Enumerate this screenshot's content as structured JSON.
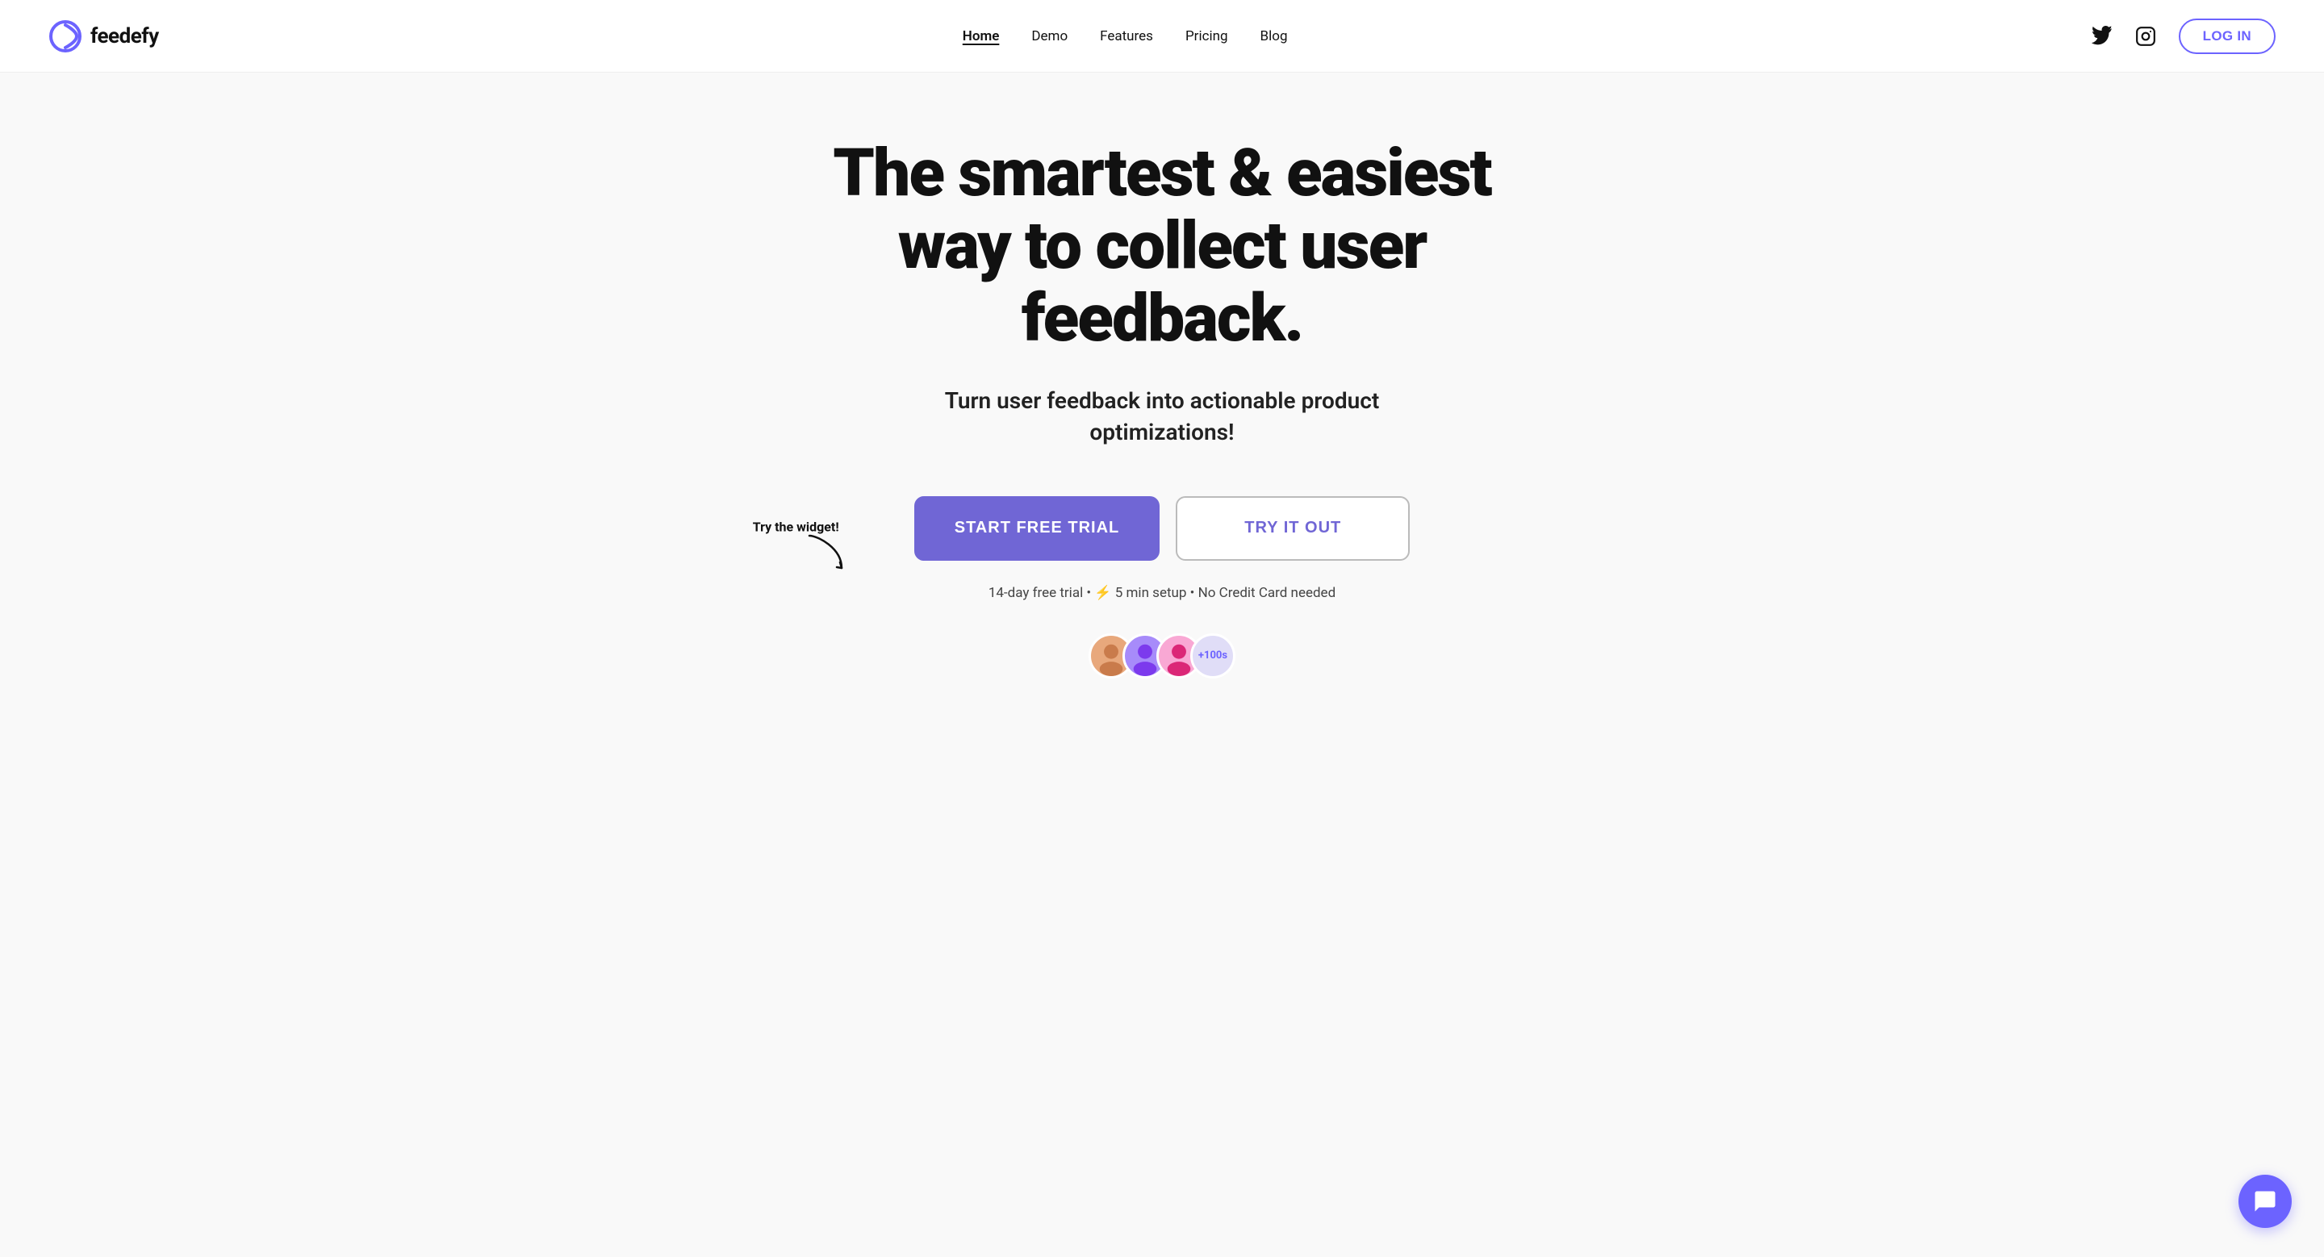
{
  "logo": {
    "text": "feedefy"
  },
  "nav": {
    "links": [
      {
        "label": "Home",
        "active": true
      },
      {
        "label": "Demo",
        "active": false
      },
      {
        "label": "Features",
        "active": false
      },
      {
        "label": "Pricing",
        "active": false
      },
      {
        "label": "Blog",
        "active": false
      }
    ],
    "login_label": "LOG IN"
  },
  "hero": {
    "title": "The smartest & easiest way to collect user feedback.",
    "subtitle": "Turn user feedback into actionable product optimizations!",
    "try_widget_label": "Try the widget!",
    "cta_primary": "START FREE TRIAL",
    "cta_secondary": "TRY IT OUT",
    "trial_info": "14-day free trial • ⚡ 5 min setup • No Credit Card needed",
    "avatar_count": "+100s"
  }
}
